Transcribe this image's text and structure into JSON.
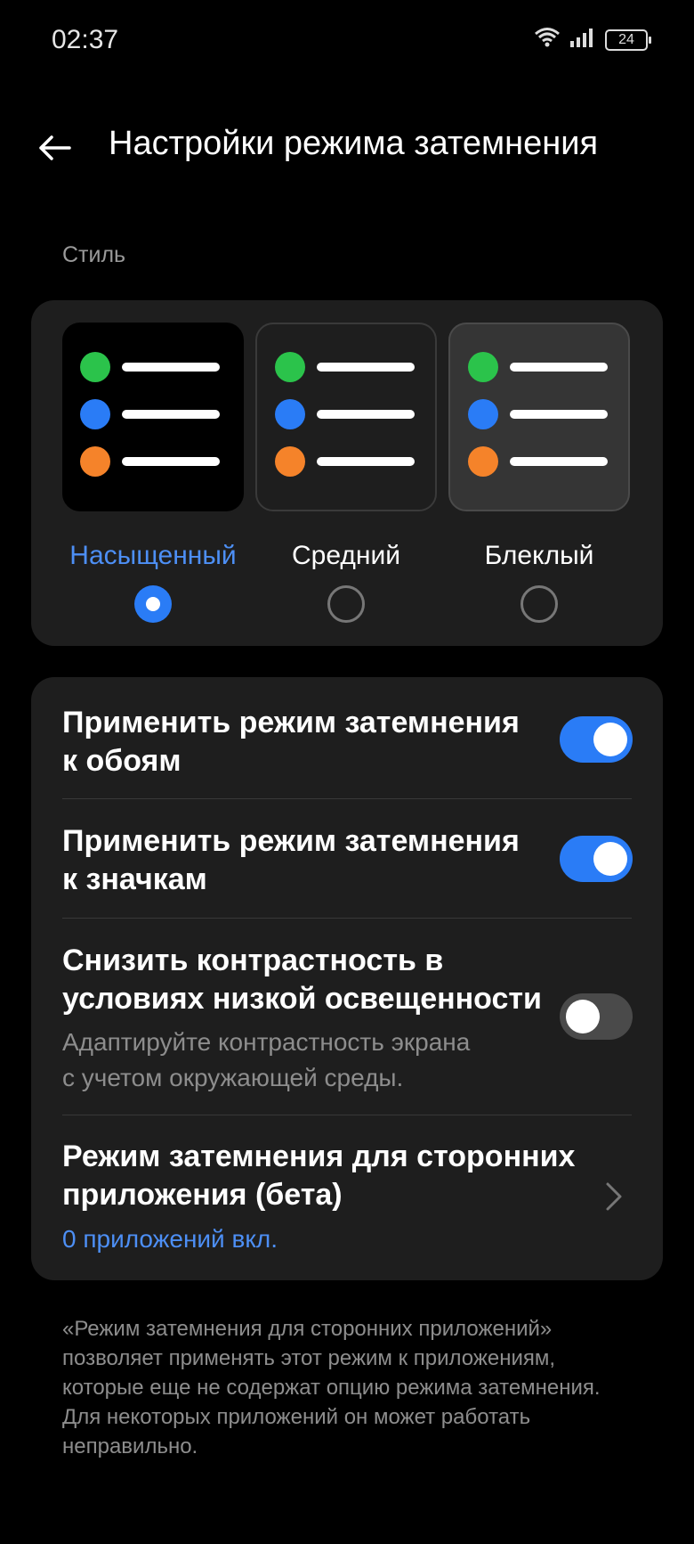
{
  "status_bar": {
    "time": "02:37",
    "battery": "24",
    "icons": [
      "wifi-icon",
      "signal-icon",
      "battery-icon"
    ]
  },
  "header": {
    "back_icon": "arrow-left-icon",
    "title": "Настройки режима затемнения"
  },
  "style_section": {
    "label": "Стиль",
    "options": [
      {
        "label": "Насыщенный",
        "selected": true
      },
      {
        "label": "Средний",
        "selected": false
      },
      {
        "label": "Блеклый",
        "selected": false
      }
    ],
    "dot_colors": [
      "#2bc34b",
      "#2a7cf6",
      "#f5832a"
    ],
    "preview_backgrounds": [
      "#000000",
      "#1e1e1e",
      "#353535"
    ]
  },
  "settings": {
    "wallpaper": {
      "title_line1": "Применить режим затемнения",
      "title_line2": "к обоям",
      "enabled": true
    },
    "icons": {
      "title_line1": "Применить режим затемнения",
      "title_line2": "к значкам",
      "enabled": true
    },
    "contrast": {
      "title_line1": "Снизить контрастность в",
      "title_line2": "условиях низкой освещенности",
      "desc_line1": "Адаптируйте контрастность экрана",
      "desc_line2": "с учетом окружающей среды.",
      "enabled": false
    },
    "third_party": {
      "title_line1": "Режим затемнения для сторонних",
      "title_line2": "приложения (бета)",
      "subtitle": "0 приложений вкл."
    }
  },
  "footnote": "«Режим затемнения для сторонних приложений» позволяет применять этот режим к приложениям, которые еще не содержат опцию режима затемнения. Для некоторых приложений он может работать неправильно.",
  "colors": {
    "accent": "#2a7cf6",
    "link": "#4d8ff5",
    "card": "#1e1e1e",
    "background": "#000000"
  }
}
